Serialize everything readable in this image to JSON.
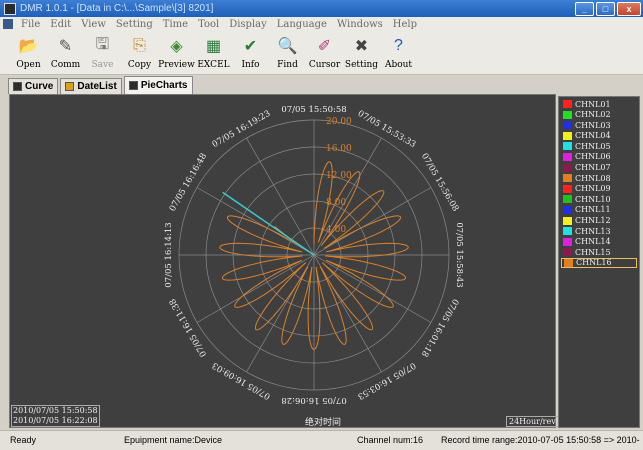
{
  "window": {
    "title": "DMR 1.0.1 - [Data in C:\\...\\Sample\\[3] 8201]",
    "buttons": {
      "minimize": "_",
      "maximize": "□",
      "close": "x"
    }
  },
  "menu": [
    "File",
    "Edit",
    "View",
    "Setting",
    "Time",
    "Tool",
    "Display",
    "Language",
    "Windows",
    "Help"
  ],
  "toolbar": [
    {
      "label": "Open",
      "icon": "open-folder-icon",
      "glyph": "📂",
      "color": "#d9a020",
      "enabled": true
    },
    {
      "label": "Comm",
      "icon": "comm-icon",
      "glyph": "✎",
      "color": "#555555",
      "enabled": true
    },
    {
      "label": "Save",
      "icon": "save-disk-icon",
      "glyph": "🖫",
      "color": "#777777",
      "enabled": false
    },
    {
      "label": "Copy",
      "icon": "copy-icon",
      "glyph": "⎘",
      "color": "#c08a20",
      "enabled": true
    },
    {
      "label": "Preview",
      "icon": "preview-icon",
      "glyph": "◈",
      "color": "#3a8a3a",
      "enabled": true
    },
    {
      "label": "EXCEL",
      "icon": "excel-icon",
      "glyph": "▦",
      "color": "#2a7a3a",
      "enabled": true
    },
    {
      "label": "Info",
      "icon": "info-icon",
      "glyph": "✔",
      "color": "#2a7a3a",
      "enabled": true
    },
    {
      "label": "Find",
      "icon": "find-magnifier-icon",
      "glyph": "🔍",
      "color": "#4a6a9a",
      "enabled": true
    },
    {
      "label": "Cursor",
      "icon": "cursor-icon",
      "glyph": "✐",
      "color": "#b03a7a",
      "enabled": true
    },
    {
      "label": "Setting",
      "icon": "setting-tools-icon",
      "glyph": "✖",
      "color": "#444444",
      "enabled": true
    },
    {
      "label": "About",
      "icon": "about-question-icon",
      "glyph": "?",
      "color": "#1a5ac0",
      "enabled": true
    }
  ],
  "tabs": [
    {
      "label": "Curve",
      "active": false
    },
    {
      "label": "DateList",
      "active": false
    },
    {
      "label": "PieCharts",
      "active": true
    }
  ],
  "chart": {
    "radial_ticks": [
      "4.00",
      "8.00",
      "12.00",
      "16.00",
      "20.00"
    ],
    "time_labels": [
      "07/05 15:50:58",
      "07/05 15:53:33",
      "07/05 15:56:08",
      "07/05 15:58:43",
      "07/05 16:01:18",
      "07/05 16:03:53",
      "07/05 16:06:28",
      "07/05 16:09:03",
      "07/05 16:11:38",
      "07/05 16:14:13",
      "07/05 16:16:48",
      "07/05 16:19:23"
    ],
    "start_time": "2010/07/05 15:50:58",
    "end_time": "2010/07/05 16:22:08",
    "axis_title": "绝对时间",
    "mode": "24Hour/rev",
    "series_color": "#d9822b",
    "cursor_color": "#3cc8c8"
  },
  "legend": [
    {
      "name": "CHNL01",
      "color": "#ff2020"
    },
    {
      "name": "CHNL02",
      "color": "#20e020"
    },
    {
      "name": "CHNL03",
      "color": "#2030e0"
    },
    {
      "name": "CHNL04",
      "color": "#f0f020"
    },
    {
      "name": "CHNL05",
      "color": "#20e0e0"
    },
    {
      "name": "CHNL06",
      "color": "#e020e0"
    },
    {
      "name": "CHNL07",
      "color": "#8a1a4a"
    },
    {
      "name": "CHNL08",
      "color": "#e08020"
    },
    {
      "name": "CHNL09",
      "color": "#ff2020"
    },
    {
      "name": "CHNL10",
      "color": "#20c020"
    },
    {
      "name": "CHNL11",
      "color": "#2030e0"
    },
    {
      "name": "CHNL12",
      "color": "#f0f020"
    },
    {
      "name": "CHNL13",
      "color": "#20e0e0"
    },
    {
      "name": "CHNL14",
      "color": "#e020e0"
    },
    {
      "name": "CHNL15",
      "color": "#8a1a4a"
    },
    {
      "name": "CHNL16",
      "color": "#e08020"
    }
  ],
  "status": {
    "state": "Ready",
    "device": "Epuipment name:Device",
    "channels": "Channel num:16",
    "range": "Record time range:2010-07-05 15:50:58 => 2010-"
  }
}
